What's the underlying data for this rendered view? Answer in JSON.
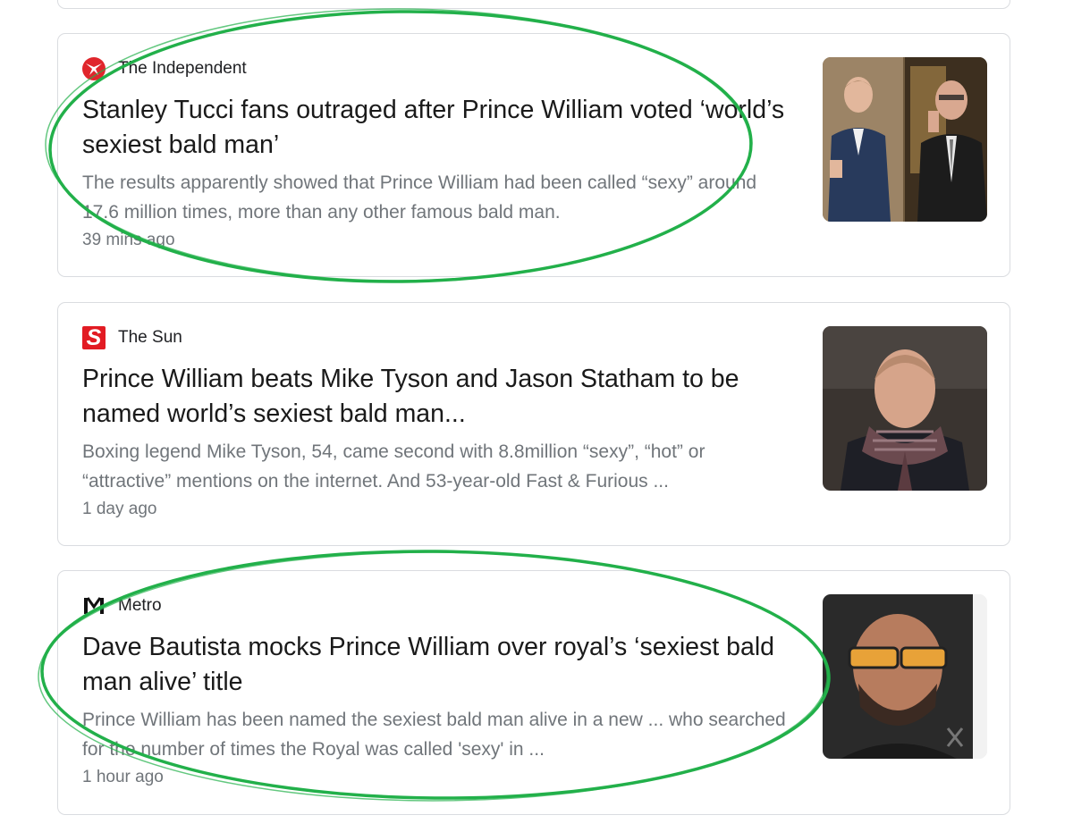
{
  "articles": [
    {
      "source": "The Independent",
      "logo_icon": "independent-eagle-icon",
      "headline": "Stanley Tucci fans outraged after Prince William voted ‘world’s sexiest bald man’",
      "snippet": "The results apparently showed that Prince William had been called “sexy” around 17.6 million times, more than any other famous bald man.",
      "time": "39 mins ago",
      "circled": true
    },
    {
      "source": "The Sun",
      "logo_icon": "sun-s-icon",
      "logo_text": "S",
      "headline": "Prince William beats Mike Tyson and Jason Statham to be named world’s sexiest bald man...",
      "snippet": "Boxing legend Mike Tyson, 54, came second with 8.8million “sexy”, “hot” or “attractive” mentions on the internet. And 53-year-old Fast & Furious ...",
      "time": "1 day ago",
      "circled": false
    },
    {
      "source": "Metro",
      "logo_icon": "metro-m-icon",
      "headline": "Dave Bautista mocks Prince William over royal’s ‘sexiest bald man alive’ title",
      "snippet": "Prince William has been named the sexiest bald man alive in a new ... who searched for the number of times the Royal was called 'sexy' in ...",
      "time": "1 hour ago",
      "circled": true
    }
  ],
  "colors": {
    "annotation_green": "#22b04a",
    "headline": "#1a1a1a",
    "snippet": "#70757a",
    "border": "#dadce0"
  }
}
